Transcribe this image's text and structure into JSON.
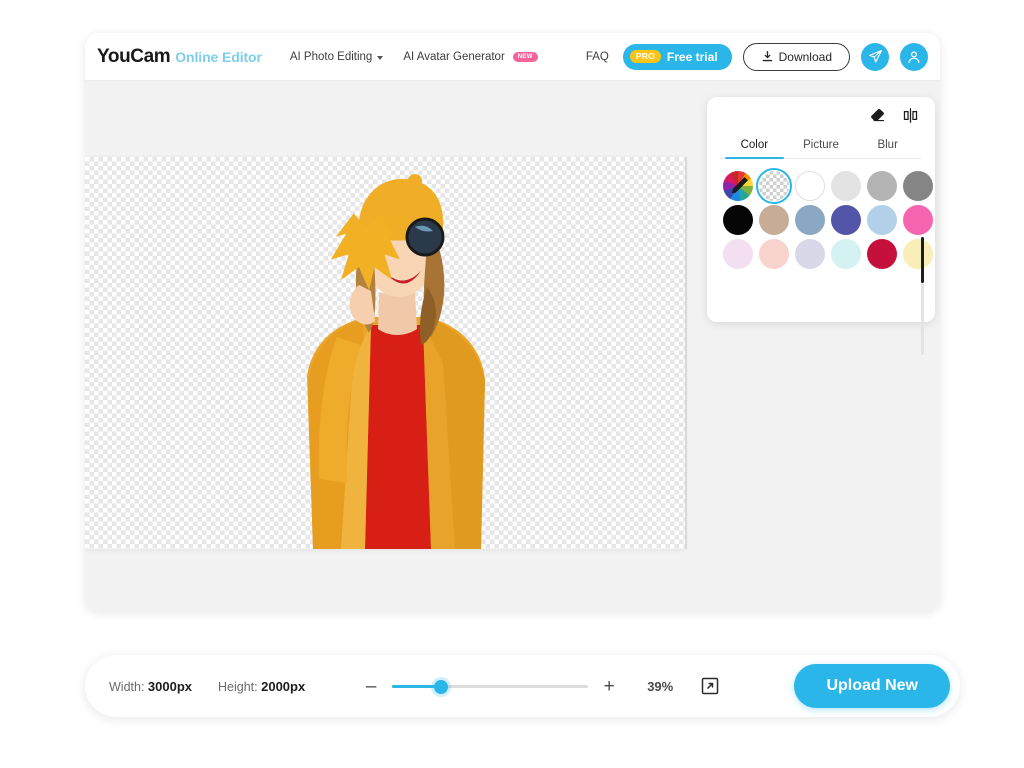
{
  "brand": {
    "name": "YouCam",
    "product": "Online Editor"
  },
  "nav": {
    "items": [
      {
        "label": "AI Photo Editing",
        "has_caret": true,
        "badge": null
      },
      {
        "label": "AI Avatar Generator",
        "has_caret": false,
        "badge": "NEW"
      }
    ],
    "faq": "FAQ"
  },
  "header_actions": {
    "pro_tag": "PRO",
    "pro_label": "Free trial",
    "download_label": "Download",
    "send_icon": "paper-plane-icon",
    "account_icon": "user-account-icon"
  },
  "panel": {
    "tools": [
      {
        "name": "eraser-icon",
        "label": "Eraser"
      },
      {
        "name": "compare-split-icon",
        "label": "Compare"
      }
    ],
    "tabs": [
      {
        "label": "Color",
        "active": true
      },
      {
        "label": "Picture",
        "active": false
      },
      {
        "label": "Blur",
        "active": false
      }
    ],
    "swatches": [
      {
        "name": "color-picker",
        "type": "picker",
        "color": null,
        "selected": false
      },
      {
        "name": "transparent",
        "type": "transparent",
        "color": null,
        "selected": true
      },
      {
        "name": "white",
        "type": "solid",
        "color": "#ffffff",
        "selected": false
      },
      {
        "name": "light-gray",
        "type": "solid",
        "color": "#e3e3e3",
        "selected": false
      },
      {
        "name": "medium-gray",
        "type": "solid",
        "color": "#b4b4b4",
        "selected": false
      },
      {
        "name": "dark-gray",
        "type": "solid",
        "color": "#858585",
        "selected": false
      },
      {
        "name": "black",
        "type": "solid",
        "color": "#060606",
        "selected": false
      },
      {
        "name": "tan",
        "type": "solid",
        "color": "#c7ad98",
        "selected": false
      },
      {
        "name": "steel-blue",
        "type": "solid",
        "color": "#8aa7c4",
        "selected": false
      },
      {
        "name": "indigo",
        "type": "solid",
        "color": "#5356a8",
        "selected": false
      },
      {
        "name": "sky-blue",
        "type": "solid",
        "color": "#b2d0e8",
        "selected": false
      },
      {
        "name": "hot-pink",
        "type": "solid",
        "color": "#f765b0",
        "selected": false
      },
      {
        "name": "pale-lavender",
        "type": "solid",
        "color": "#f3dff0",
        "selected": false
      },
      {
        "name": "pale-peach",
        "type": "solid",
        "color": "#f8d2cd",
        "selected": false
      },
      {
        "name": "pale-periwinkle",
        "type": "solid",
        "color": "#d8d8e8",
        "selected": false
      },
      {
        "name": "pale-cyan",
        "type": "solid",
        "color": "#d4f2f2",
        "selected": false
      },
      {
        "name": "crimson",
        "type": "solid",
        "color": "#c6103c",
        "selected": false
      },
      {
        "name": "pale-yellow",
        "type": "solid",
        "color": "#f9edb8",
        "selected": false
      }
    ]
  },
  "bottom_bar": {
    "width_label": "Width:",
    "width_value": "3000px",
    "height_label": "Height:",
    "height_value": "2000px",
    "zoom_out": "–",
    "zoom_in": "+",
    "zoom_percent": "39%",
    "zoom_slider_value": 25,
    "fit_icon": "fit-to-screen-icon",
    "upload_label": "Upload New"
  },
  "colors": {
    "accent": "#2ab6e8",
    "brand_sub": "#7dcfe8",
    "badge_new": "#f4649b",
    "pro_gold": "#fcc419",
    "canvas_bg": "#f2f2f2"
  }
}
